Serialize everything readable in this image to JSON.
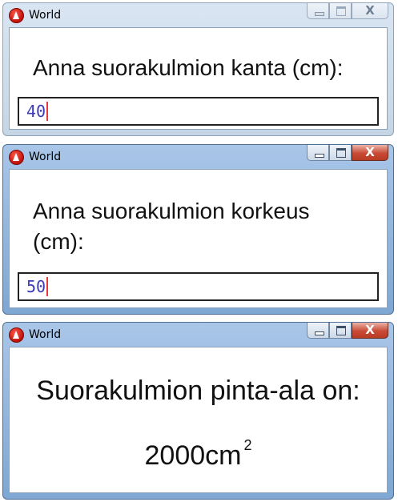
{
  "windows": [
    {
      "title": "World",
      "state": "inactive",
      "prompt_lines": [
        "Anna suorakulmion kanta (cm):"
      ],
      "input_value": "40"
    },
    {
      "title": "World",
      "state": "active",
      "prompt_lines": [
        "Anna suorakulmion korkeus",
        "(cm):"
      ],
      "input_value": "50"
    },
    {
      "title": "World",
      "state": "active",
      "result_label": "Suorakulmion pinta-ala on:",
      "result_number": "2000",
      "result_unit": "cm",
      "result_exponent": "2"
    }
  ],
  "controls": {
    "close_glyph": "X"
  },
  "colors": {
    "input_text": "#3b3bb8",
    "caret": "#e8383a",
    "close_button": "#c94a35"
  },
  "icons": {
    "app_icon": "red-circle-A-icon",
    "minimize": "minimize-icon",
    "maximize": "maximize-icon",
    "close": "close-icon"
  }
}
